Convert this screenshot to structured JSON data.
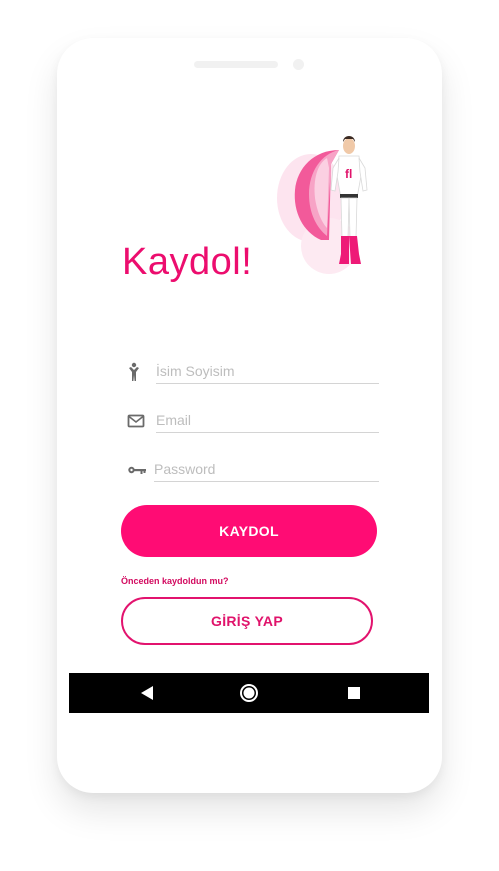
{
  "signup": {
    "title": "Kaydol!",
    "fields": {
      "name_placeholder": "İsim Soyisim",
      "email_placeholder": "Email",
      "password_placeholder": "Password"
    },
    "submit_label": "KAYDOL",
    "already_registered": "Önceden kaydoldun mu?",
    "login_label": "GİRİŞ YAP"
  },
  "icons": {
    "name_field": "person-icon",
    "email_field": "envelope-icon",
    "password_field": "key-icon",
    "nav_back": "back-triangle-icon",
    "nav_home": "home-circle-icon",
    "nav_recent": "recent-square-icon"
  },
  "colors": {
    "accent": "#ff0c74",
    "title": "#ec0d6e",
    "outline": "#e2136e",
    "navbar": "#000000"
  }
}
